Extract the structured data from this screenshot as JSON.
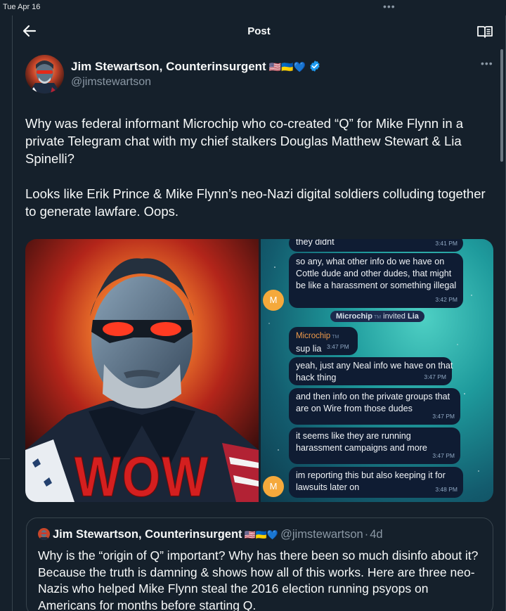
{
  "status_bar": {
    "time": "Tue Apr 16",
    "dots": "•••"
  },
  "header": {
    "title": "Post"
  },
  "author": {
    "name": "Jim Stewartson, Counterinsurgent",
    "flags": "🇺🇸🇺🇦💙",
    "handle": "@jimstewartson",
    "more": "•••"
  },
  "tweet": {
    "paragraph_1": "Why was federal informant Microchip who co-created “Q” for Mike Flynn in a private Telegram chat with my chief stalkers Douglas Matthew Stewart & Lia Spinelli?",
    "paragraph_2": "Looks like Erik Prince & Mike Flynn’s neo-Nazi digital soldiers colluding together to generate lawfare. Oops."
  },
  "media": {
    "image_caption": "WOW",
    "chat": {
      "avatar_letter": "M",
      "tm_mark": "TM",
      "service_message": {
        "actor": "Microchip",
        "verb": "invited",
        "target": "Lia"
      },
      "messages": [
        {
          "text": "they didnt",
          "time": "3:41 PM"
        },
        {
          "text": "so any, what other info do we have on Cottle dude and other dudes, that might be like  a harassment or something illegal",
          "time": "3:42 PM"
        },
        {
          "sender": "Microchip",
          "text": "sup lia",
          "time": "3:47 PM"
        },
        {
          "text": "yeah, just any Neal info we have on that hack thing",
          "time": "3:47 PM"
        },
        {
          "text": "and then info on the private groups that are on Wire from those dudes",
          "time": "3:47 PM"
        },
        {
          "text": "it seems  like they are running harassment campaigns and more",
          "time": "3:47 PM"
        },
        {
          "text": "im reporting this but also keeping it for lawsuits later on",
          "time": "3:48 PM"
        }
      ]
    }
  },
  "quote": {
    "name": "Jim Stewartson, Counterinsurgent",
    "flags": "🇺🇸🇺🇦💙",
    "handle": "@jimstewartson",
    "separator": "·",
    "age": "4d",
    "text": "Why is the “origin of Q” important? Why has there been so much disinfo about it? Because the truth is damning & shows how all of this works. Here are three neo-Nazis who helped Mike Flynn steal the 2016 election running psyops on Americans for months before starting Q."
  },
  "colors": {
    "background": "#15202b",
    "border": "#38444d",
    "secondary_text": "#8b98a5",
    "verified": "#1d9bf0",
    "wow_red": "#d41f1f",
    "chat_bubble": "#0f1c33"
  },
  "icons": {
    "back": "arrow-left-icon",
    "reader": "book-open-icon",
    "verified": "verified-badge-icon",
    "more": "more-horizontal-icon"
  }
}
